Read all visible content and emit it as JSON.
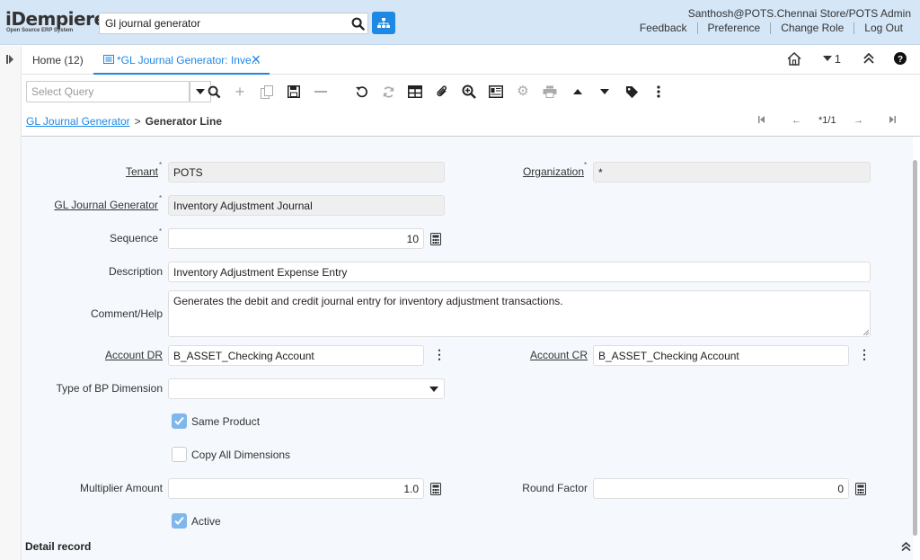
{
  "header": {
    "logo_text": "iDempiere",
    "logo_sub": "Open Source ERP System",
    "search_value": "Gl journal generator",
    "user": "Santhosh@POTS.Chennai Store/POTS Admin",
    "links": [
      "Feedback",
      "Preference",
      "Change Role",
      "Log Out"
    ]
  },
  "tabs": {
    "home_label": "Home (12)",
    "active_label": "*GL Journal Generator: Inve...",
    "window_count": "1"
  },
  "toolbar": {
    "query_placeholder": "Select Query"
  },
  "breadcrumb": {
    "parent": "GL Journal Generator",
    "separator": ">",
    "current": "Generator Line",
    "record": "*1/1"
  },
  "form": {
    "tenant_label": "Tenant",
    "tenant_value": "POTS",
    "organization_label": "Organization",
    "organization_value": "*",
    "generator_label": "GL Journal Generator",
    "generator_value": "Inventory Adjustment Journal",
    "sequence_label": "Sequence",
    "sequence_value": "10",
    "description_label": "Description",
    "description_value": "Inventory Adjustment Expense Entry",
    "comment_label": "Comment/Help",
    "comment_value": "Generates the debit and credit journal entry for inventory adjustment transactions.",
    "account_dr_label": "Account DR",
    "account_dr_value": "B_ASSET_Checking Account",
    "account_cr_label": "Account CR",
    "account_cr_value": "B_ASSET_Checking Account",
    "bp_dimension_label": "Type of BP Dimension",
    "bp_dimension_value": "",
    "same_product_label": "Same Product",
    "same_product_checked": true,
    "copy_all_label": "Copy All Dimensions",
    "copy_all_checked": false,
    "multiplier_label": "Multiplier Amount",
    "multiplier_value": "1.0",
    "round_factor_label": "Round Factor",
    "round_factor_value": "0",
    "active_label": "Active",
    "active_checked": true
  },
  "detail": {
    "label": "Detail record"
  },
  "colors": {
    "accent": "#1e88e5",
    "header_bg": "#d5e6f7",
    "form_bg": "#f5f9fd",
    "checkbox_on": "#7fb6ec"
  }
}
